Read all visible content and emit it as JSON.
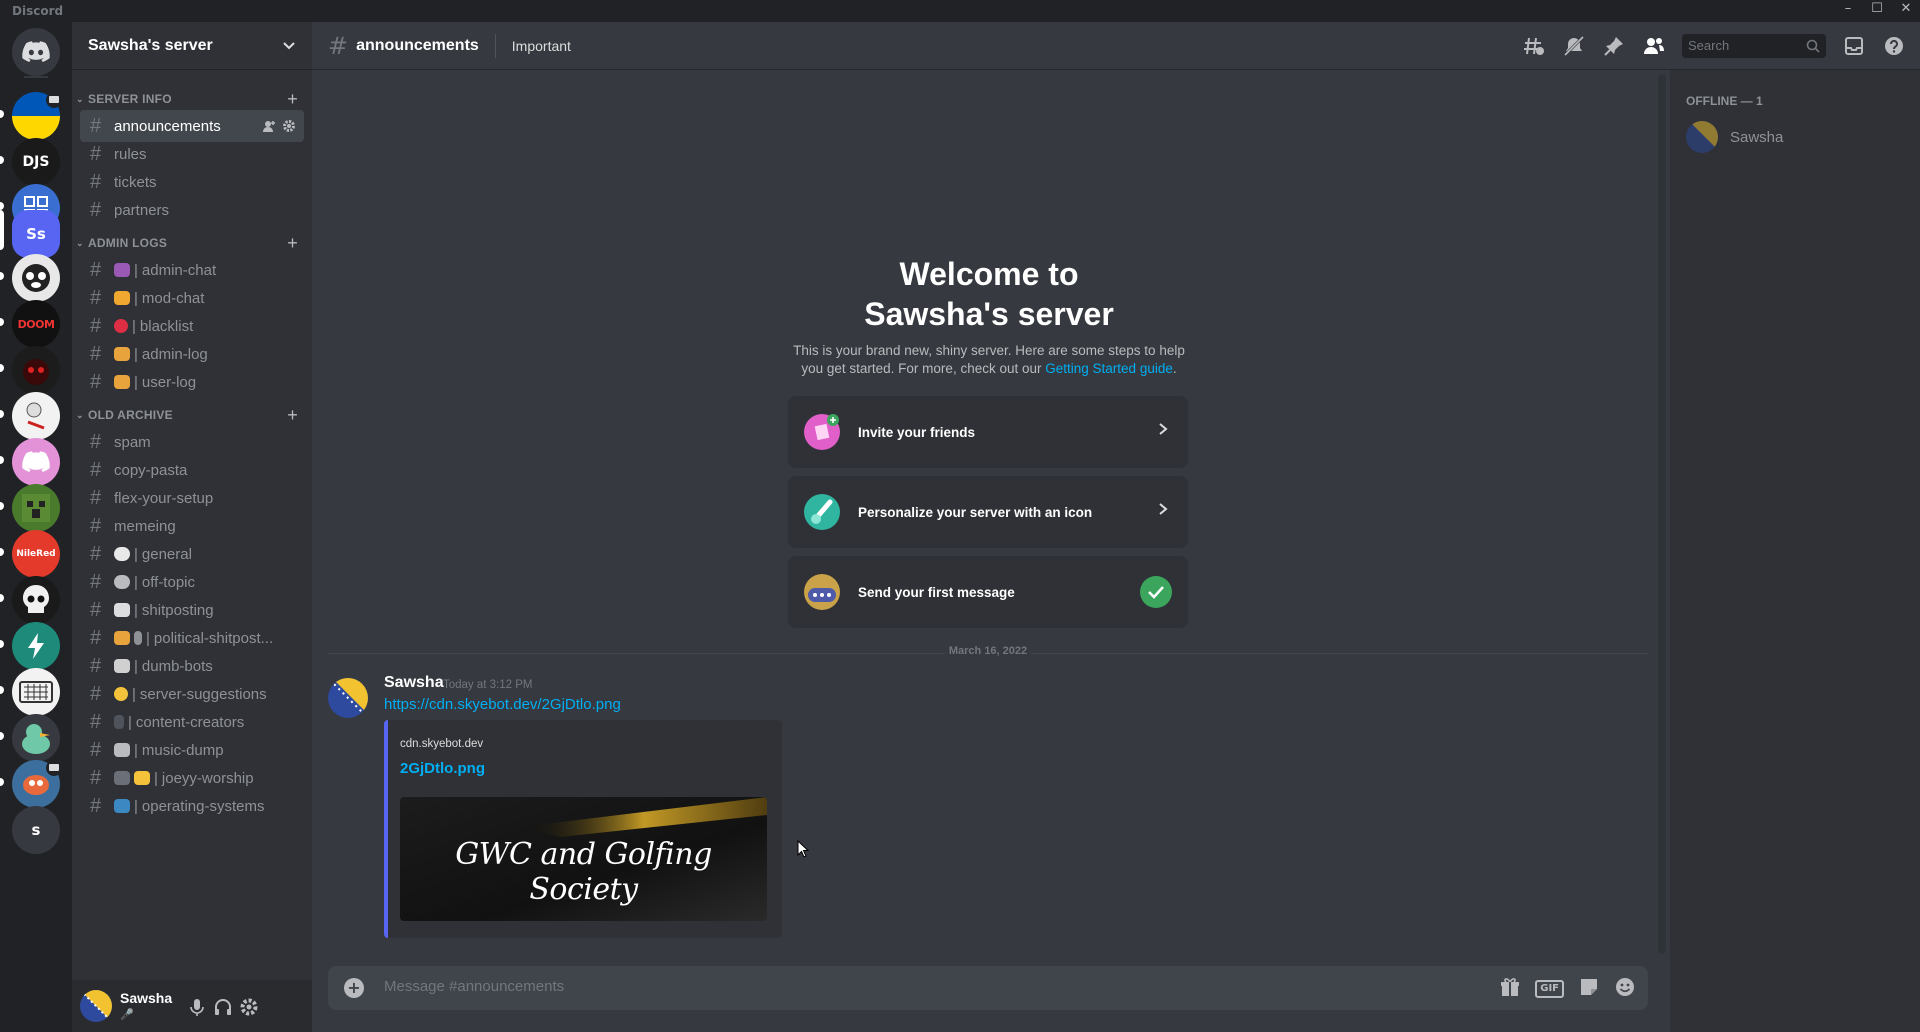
{
  "window": {
    "app_name": "Discord",
    "minimize": "–",
    "maximize": "☐",
    "close": "✕"
  },
  "rail": {
    "home_icon": "discord-logo-icon",
    "servers": [
      {
        "name": "ukraine-flag",
        "abbr": ""
      },
      {
        "name": "djs",
        "abbr": "DJS"
      },
      {
        "name": "grid-app",
        "abbr": ""
      },
      {
        "name": "sawsha-server",
        "abbr": "Ss"
      },
      {
        "name": "panda",
        "abbr": ""
      },
      {
        "name": "doom-eternal",
        "abbr": "DOOM"
      },
      {
        "name": "dark-creature",
        "abbr": ""
      },
      {
        "name": "stickman",
        "abbr": ""
      },
      {
        "name": "pink-discord",
        "abbr": ""
      },
      {
        "name": "creeper-face",
        "abbr": ""
      },
      {
        "name": "nile-red",
        "abbr": "NileRed"
      },
      {
        "name": "skull",
        "abbr": ""
      },
      {
        "name": "lightning",
        "abbr": ""
      },
      {
        "name": "keyboard",
        "abbr": ""
      },
      {
        "name": "duck",
        "abbr": ""
      },
      {
        "name": "robot-fish",
        "abbr": ""
      },
      {
        "name": "s-server",
        "abbr": "s"
      }
    ]
  },
  "sidebar": {
    "server_name": "Sawsha's server",
    "categories": [
      {
        "name": "SERVER INFO"
      },
      {
        "name": "ADMIN LOGS"
      },
      {
        "name": "OLD ARCHIVE"
      }
    ],
    "channels_server_info": [
      "announcements",
      "rules",
      "tickets",
      "partners"
    ],
    "channels_admin_logs": [
      "admin-chat",
      "mod-chat",
      "blacklist",
      "admin-log",
      "user-log"
    ],
    "channels_old_archive": [
      "spam",
      "copy-pasta",
      "flex-your-setup",
      "memeing",
      "general",
      "off-topic",
      "shitposting",
      "political-shitpost...",
      "dumb-bots",
      "server-suggestions",
      "content-creators",
      "music-dump",
      "joeyy-worship",
      "operating-systems"
    ],
    "emoji_separator": "|",
    "hash": "#"
  },
  "user_panel": {
    "username": "Sawsha",
    "status": "🎤"
  },
  "header": {
    "channel": "announcements",
    "topic": "Important",
    "search_placeholder": "Search"
  },
  "welcome": {
    "title_line1": "Welcome to",
    "title_line2": "Sawsha's server",
    "subtitle": "This is your brand new, shiny server. Here are some steps to help",
    "subtitle2": "you get started. For more, check out our",
    "guide_link": "Getting Started guide",
    "period": ".",
    "steps": [
      "Invite your friends",
      "Personalize your server with an icon",
      "Send your first message"
    ]
  },
  "date_divider": "March 16, 2022",
  "message": {
    "author": "Sawsha",
    "time": "Today at 3:12 PM",
    "link": "https://cdn.skyebot.dev/2GjDtlo.png",
    "embed": {
      "provider": "cdn.skyebot.dev",
      "title": "2GjDtlo.png",
      "image_caption": "GWC and Golfing Society"
    }
  },
  "composer": {
    "placeholder": "Message #announcements",
    "gif": "GIF",
    "add": "+"
  },
  "members": {
    "header": "OFFLINE — 1",
    "list": [
      {
        "name": "Sawsha"
      }
    ]
  },
  "colors": {
    "accent": "#5865f2",
    "link": "#00aff4",
    "online": "#3ba55d",
    "bg_chat": "#36393f",
    "bg_sidebar": "#2f3136"
  }
}
